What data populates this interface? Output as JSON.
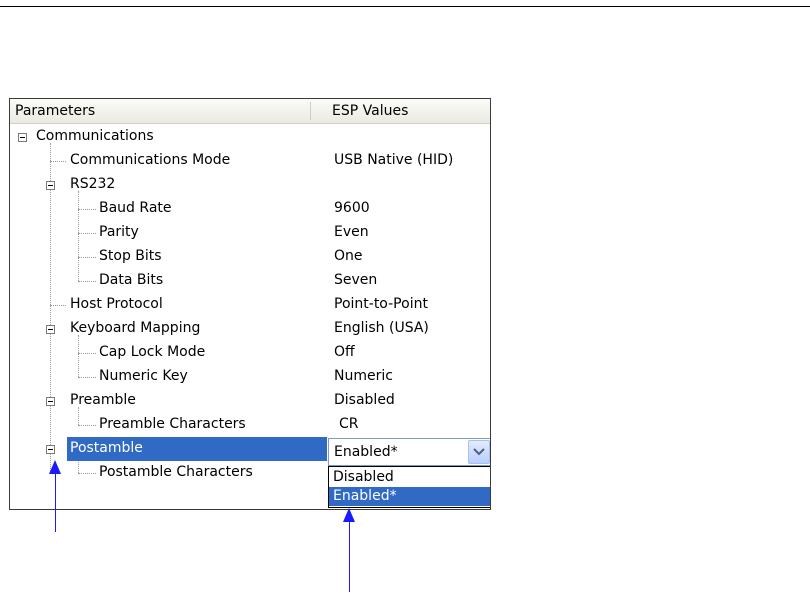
{
  "header": {
    "left": "Parameters",
    "right": "ESP Values"
  },
  "rows": [
    {
      "label": "Communications",
      "value": ""
    },
    {
      "label": "Communications Mode",
      "value": "USB Native (HID)"
    },
    {
      "label": "RS232",
      "value": ""
    },
    {
      "label": "Baud Rate",
      "value": "9600"
    },
    {
      "label": "Parity",
      "value": "Even"
    },
    {
      "label": "Stop Bits",
      "value": "One"
    },
    {
      "label": "Data Bits",
      "value": "Seven"
    },
    {
      "label": "Host Protocol",
      "value": "Point-to-Point"
    },
    {
      "label": "Keyboard Mapping",
      "value": "English (USA)"
    },
    {
      "label": "Cap Lock Mode",
      "value": "Off"
    },
    {
      "label": "Numeric Key",
      "value": "Numeric"
    },
    {
      "label": "Preamble",
      "value": "Disabled"
    },
    {
      "label": "Preamble Characters",
      "value": "CR"
    },
    {
      "label": "Postamble",
      "value": ""
    },
    {
      "label": "Postamble Characters",
      "value": ""
    }
  ],
  "combo": {
    "selected": "Enabled*",
    "options": [
      "Disabled",
      "Enabled*"
    ],
    "highlighted_index": 1
  },
  "colors": {
    "selection": "#316ac5",
    "arrow": "#1a1aff"
  }
}
